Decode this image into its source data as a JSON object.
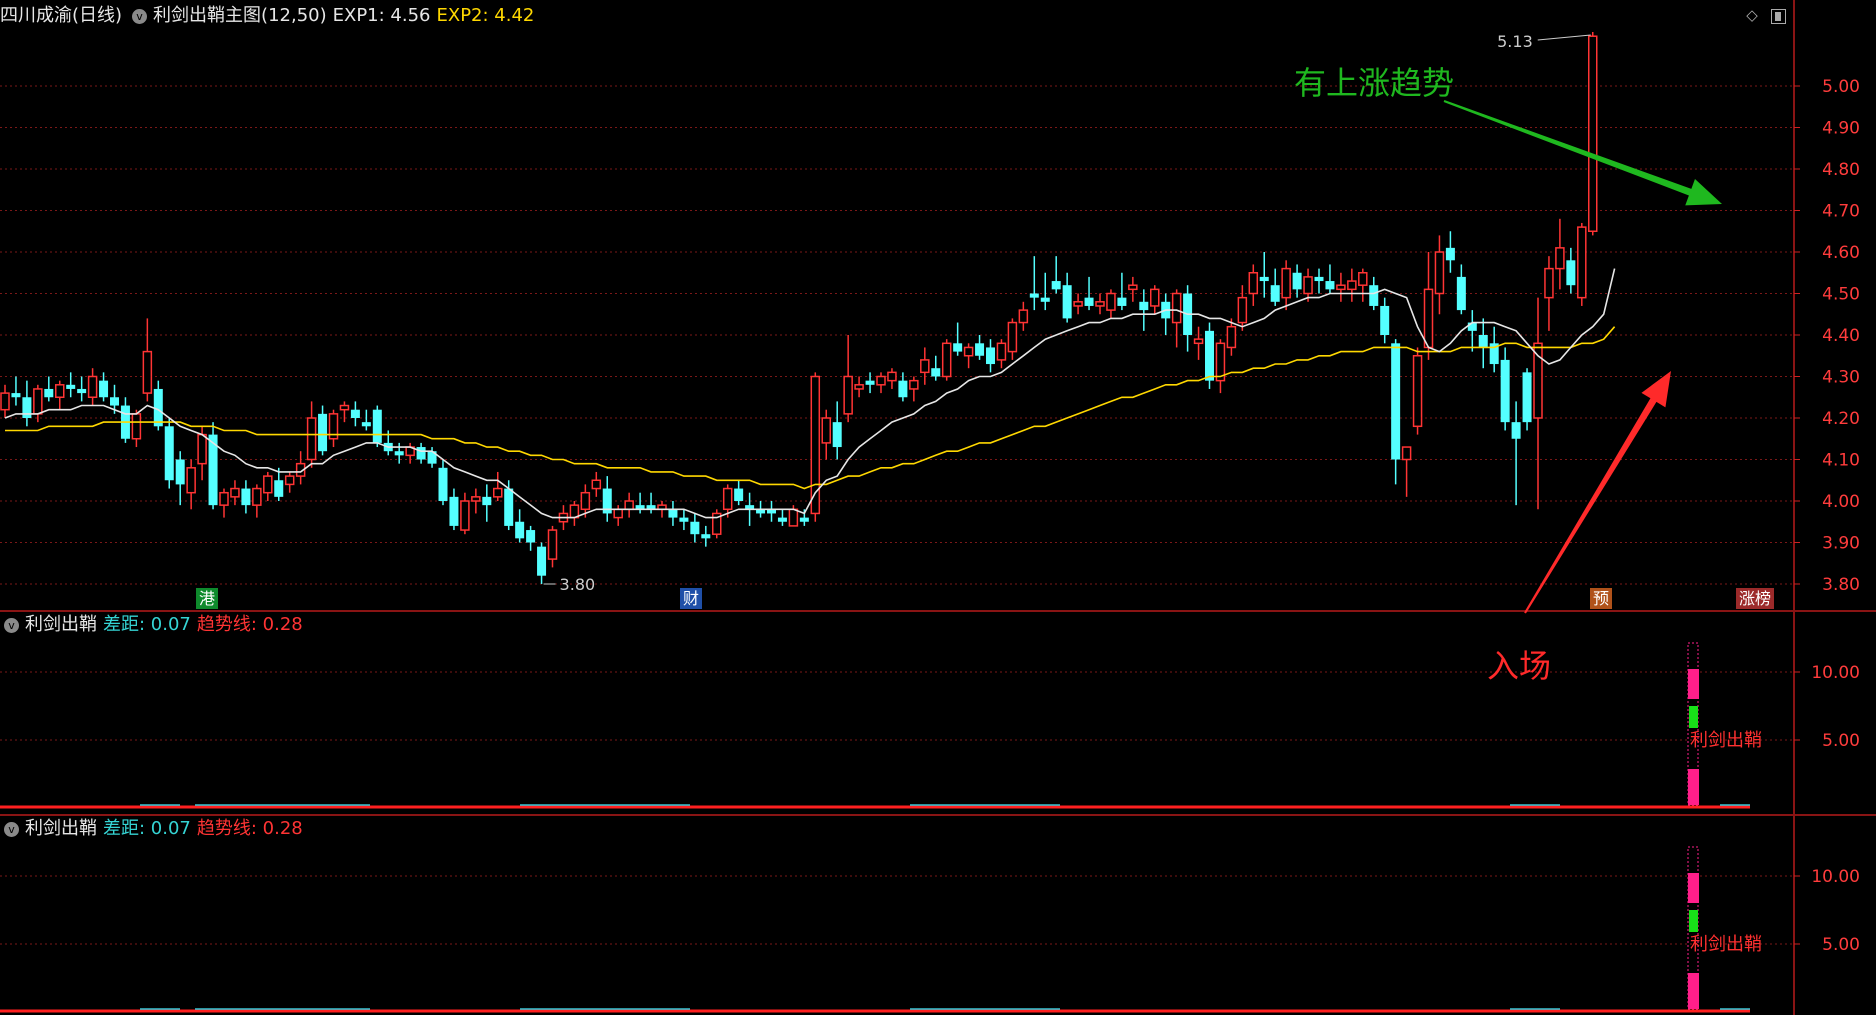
{
  "main": {
    "title_stock": "四川成渝(日线)",
    "indicator_name": "利剑出鞘主图(12,50)",
    "exp1_label": "EXP1: 4.56",
    "exp2_label": "EXP2: 4.42",
    "price_axis_labels": [
      "5.00",
      "4.90",
      "4.80",
      "4.70",
      "4.60",
      "4.50",
      "4.40",
      "4.30",
      "4.20",
      "4.10",
      "4.00",
      "3.90",
      "3.80"
    ],
    "high_label": "5.13",
    "low_label": "3.80",
    "markers": {
      "hk": "港",
      "fin": "财",
      "pre": "预",
      "zb": "涨榜"
    }
  },
  "annotations": {
    "uptrend": "有上涨趋势",
    "entry": "入场"
  },
  "sub1": {
    "name": "利剑出鞘",
    "diff_label": "差距: 0.07",
    "trend_label": "趋势线: 0.28",
    "axis_labels": [
      "10.00",
      "5.00"
    ],
    "signal_text": "利剑出鞘"
  },
  "sub2": {
    "name": "利剑出鞘",
    "diff_label": "差距: 0.07",
    "trend_label": "趋势线: 0.28",
    "axis_labels": [
      "10.00",
      "5.00"
    ],
    "signal_text": "利剑出鞘"
  },
  "colors": {
    "background": "#000000",
    "up": "#ff3434",
    "down": "#54ffff",
    "grid": "#7a1818",
    "exp1_line": "#e6e6e6",
    "exp2_line": "#ffd800",
    "uptrend_arrow": "#1fb81f",
    "entry_arrow": "#ff2a2a",
    "signal_magenta": "#ff1f8a",
    "signal_green": "#18e018"
  },
  "candles": [
    [
      4.22,
      4.28,
      4.2,
      4.26
    ],
    [
      4.26,
      4.3,
      4.23,
      4.25
    ],
    [
      4.25,
      4.29,
      4.18,
      4.2
    ],
    [
      4.21,
      4.28,
      4.19,
      4.27
    ],
    [
      4.27,
      4.3,
      4.24,
      4.25
    ],
    [
      4.25,
      4.29,
      4.22,
      4.28
    ],
    [
      4.28,
      4.31,
      4.25,
      4.27
    ],
    [
      4.27,
      4.3,
      4.24,
      4.26
    ],
    [
      4.25,
      4.32,
      4.23,
      4.3
    ],
    [
      4.29,
      4.31,
      4.24,
      4.25
    ],
    [
      4.25,
      4.28,
      4.21,
      4.23
    ],
    [
      4.23,
      4.25,
      4.14,
      4.15
    ],
    [
      4.15,
      4.22,
      4.13,
      4.21
    ],
    [
      4.26,
      4.44,
      4.24,
      4.36
    ],
    [
      4.27,
      4.29,
      4.17,
      4.18
    ],
    [
      4.18,
      4.2,
      4.03,
      4.05
    ],
    [
      4.1,
      4.12,
      3.99,
      4.04
    ],
    [
      4.02,
      4.1,
      3.98,
      4.08
    ],
    [
      4.09,
      4.18,
      4.05,
      4.16
    ],
    [
      4.16,
      4.19,
      3.98,
      3.99
    ],
    [
      3.99,
      4.03,
      3.96,
      4.02
    ],
    [
      4.01,
      4.05,
      3.99,
      4.03
    ],
    [
      4.03,
      4.05,
      3.97,
      3.99
    ],
    [
      3.99,
      4.04,
      3.96,
      4.03
    ],
    [
      4.02,
      4.07,
      4.0,
      4.06
    ],
    [
      4.05,
      4.08,
      4.0,
      4.01
    ],
    [
      4.04,
      4.07,
      4.02,
      4.06
    ],
    [
      4.06,
      4.12,
      4.04,
      4.09
    ],
    [
      4.1,
      4.24,
      4.08,
      4.2
    ],
    [
      4.21,
      4.23,
      4.11,
      4.12
    ],
    [
      4.15,
      4.22,
      4.13,
      4.21
    ],
    [
      4.22,
      4.24,
      4.19,
      4.23
    ],
    [
      4.22,
      4.24,
      4.18,
      4.2
    ],
    [
      4.19,
      4.22,
      4.17,
      4.18
    ],
    [
      4.22,
      4.23,
      4.13,
      4.14
    ],
    [
      4.14,
      4.17,
      4.11,
      4.12
    ],
    [
      4.12,
      4.14,
      4.09,
      4.11
    ],
    [
      4.11,
      4.14,
      4.09,
      4.13
    ],
    [
      4.13,
      4.14,
      4.09,
      4.1
    ],
    [
      4.12,
      4.13,
      4.08,
      4.09
    ],
    [
      4.08,
      4.1,
      3.99,
      4.0
    ],
    [
      4.01,
      4.03,
      3.93,
      3.94
    ],
    [
      3.93,
      4.02,
      3.92,
      4.0
    ],
    [
      4.0,
      4.03,
      3.97,
      4.01
    ],
    [
      4.01,
      4.04,
      3.95,
      3.99
    ],
    [
      4.01,
      4.07,
      4.0,
      4.03
    ],
    [
      4.03,
      4.05,
      3.93,
      3.94
    ],
    [
      3.95,
      3.98,
      3.9,
      3.91
    ],
    [
      3.93,
      3.94,
      3.88,
      3.9
    ],
    [
      3.89,
      3.9,
      3.8,
      3.82
    ],
    [
      3.86,
      3.94,
      3.84,
      3.93
    ],
    [
      3.95,
      3.99,
      3.93,
      3.97
    ],
    [
      3.96,
      4.0,
      3.94,
      3.99
    ],
    [
      3.98,
      4.04,
      3.96,
      4.02
    ],
    [
      4.03,
      4.07,
      4.01,
      4.05
    ],
    [
      4.03,
      4.06,
      3.95,
      3.97
    ],
    [
      3.96,
      3.99,
      3.94,
      3.98
    ],
    [
      3.98,
      4.02,
      3.96,
      4.0
    ],
    [
      3.99,
      4.02,
      3.97,
      3.98
    ],
    [
      3.99,
      4.02,
      3.97,
      3.98
    ],
    [
      3.98,
      4.0,
      3.96,
      3.99
    ],
    [
      3.98,
      4.0,
      3.94,
      3.96
    ],
    [
      3.96,
      3.98,
      3.93,
      3.95
    ],
    [
      3.95,
      3.97,
      3.9,
      3.92
    ],
    [
      3.92,
      3.94,
      3.89,
      3.91
    ],
    [
      3.92,
      3.98,
      3.91,
      3.97
    ],
    [
      3.98,
      4.04,
      3.96,
      4.03
    ],
    [
      4.03,
      4.05,
      3.99,
      4.0
    ],
    [
      3.99,
      4.02,
      3.94,
      3.98
    ],
    [
      3.98,
      4.0,
      3.96,
      3.97
    ],
    [
      3.98,
      4.0,
      3.95,
      3.97
    ],
    [
      3.96,
      3.98,
      3.94,
      3.95
    ],
    [
      3.94,
      3.99,
      3.94,
      3.98
    ],
    [
      3.96,
      3.98,
      3.94,
      3.95
    ],
    [
      3.97,
      4.31,
      3.95,
      4.3
    ],
    [
      4.14,
      4.22,
      4.1,
      4.2
    ],
    [
      4.19,
      4.24,
      4.1,
      4.13
    ],
    [
      4.21,
      4.4,
      4.19,
      4.3
    ],
    [
      4.27,
      4.3,
      4.25,
      4.28
    ],
    [
      4.29,
      4.31,
      4.26,
      4.28
    ],
    [
      4.28,
      4.31,
      4.26,
      4.3
    ],
    [
      4.29,
      4.32,
      4.27,
      4.31
    ],
    [
      4.29,
      4.31,
      4.24,
      4.25
    ],
    [
      4.27,
      4.3,
      4.24,
      4.29
    ],
    [
      4.31,
      4.37,
      4.28,
      4.34
    ],
    [
      4.32,
      4.35,
      4.29,
      4.3
    ],
    [
      4.3,
      4.39,
      4.29,
      4.38
    ],
    [
      4.38,
      4.43,
      4.35,
      4.36
    ],
    [
      4.35,
      4.38,
      4.32,
      4.37
    ],
    [
      4.38,
      4.4,
      4.34,
      4.35
    ],
    [
      4.37,
      4.39,
      4.31,
      4.33
    ],
    [
      4.34,
      4.39,
      4.32,
      4.38
    ],
    [
      4.36,
      4.44,
      4.34,
      4.43
    ],
    [
      4.43,
      4.48,
      4.41,
      4.46
    ],
    [
      4.5,
      4.59,
      4.46,
      4.49
    ],
    [
      4.49,
      4.55,
      4.46,
      4.48
    ],
    [
      4.53,
      4.59,
      4.5,
      4.51
    ],
    [
      4.52,
      4.55,
      4.43,
      4.44
    ],
    [
      4.47,
      4.5,
      4.45,
      4.48
    ],
    [
      4.49,
      4.54,
      4.46,
      4.47
    ],
    [
      4.47,
      4.5,
      4.45,
      4.48
    ],
    [
      4.46,
      4.51,
      4.44,
      4.5
    ],
    [
      4.49,
      4.55,
      4.46,
      4.47
    ],
    [
      4.51,
      4.54,
      4.48,
      4.52
    ],
    [
      4.48,
      4.51,
      4.41,
      4.46
    ],
    [
      4.47,
      4.52,
      4.45,
      4.51
    ],
    [
      4.48,
      4.5,
      4.4,
      4.44
    ],
    [
      4.43,
      4.51,
      4.37,
      4.5
    ],
    [
      4.5,
      4.52,
      4.36,
      4.4
    ],
    [
      4.38,
      4.42,
      4.34,
      4.39
    ],
    [
      4.41,
      4.43,
      4.27,
      4.29
    ],
    [
      4.29,
      4.39,
      4.26,
      4.38
    ],
    [
      4.37,
      4.44,
      4.35,
      4.42
    ],
    [
      4.43,
      4.52,
      4.41,
      4.49
    ],
    [
      4.5,
      4.57,
      4.47,
      4.55
    ],
    [
      4.54,
      4.6,
      4.49,
      4.53
    ],
    [
      4.52,
      4.56,
      4.47,
      4.48
    ],
    [
      4.49,
      4.58,
      4.46,
      4.56
    ],
    [
      4.55,
      4.57,
      4.49,
      4.51
    ],
    [
      4.5,
      4.56,
      4.48,
      4.54
    ],
    [
      4.54,
      4.56,
      4.5,
      4.53
    ],
    [
      4.53,
      4.57,
      4.5,
      4.51
    ],
    [
      4.51,
      4.55,
      4.48,
      4.52
    ],
    [
      4.51,
      4.56,
      4.48,
      4.53
    ],
    [
      4.52,
      4.56,
      4.48,
      4.55
    ],
    [
      4.52,
      4.54,
      4.46,
      4.47
    ],
    [
      4.47,
      4.49,
      4.38,
      4.4
    ],
    [
      4.38,
      4.39,
      4.04,
      4.1
    ],
    [
      4.1,
      4.13,
      4.01,
      4.13
    ],
    [
      4.18,
      4.37,
      4.16,
      4.35
    ],
    [
      4.37,
      4.6,
      4.34,
      4.51
    ],
    [
      4.5,
      4.64,
      4.45,
      4.6
    ],
    [
      4.61,
      4.65,
      4.55,
      4.58
    ],
    [
      4.54,
      4.57,
      4.45,
      4.46
    ],
    [
      4.43,
      4.46,
      4.36,
      4.41
    ],
    [
      4.4,
      4.44,
      4.32,
      4.37
    ],
    [
      4.38,
      4.42,
      4.31,
      4.33
    ],
    [
      4.34,
      4.37,
      4.17,
      4.19
    ],
    [
      4.19,
      4.24,
      3.99,
      4.15
    ],
    [
      4.31,
      4.32,
      4.17,
      4.19
    ],
    [
      4.2,
      4.49,
      3.98,
      4.38
    ],
    [
      4.49,
      4.59,
      4.41,
      4.56
    ],
    [
      4.56,
      4.68,
      4.51,
      4.61
    ],
    [
      4.58,
      4.61,
      4.5,
      4.52
    ],
    [
      4.49,
      4.67,
      4.47,
      4.66
    ],
    [
      4.65,
      5.13,
      4.64,
      5.12
    ]
  ],
  "exp1": [
    4.2,
    4.21,
    4.21,
    4.21,
    4.22,
    4.22,
    4.22,
    4.23,
    4.23,
    4.23,
    4.22,
    4.21,
    4.21,
    4.23,
    4.22,
    4.2,
    4.18,
    4.17,
    4.16,
    4.14,
    4.12,
    4.11,
    4.09,
    4.08,
    4.08,
    4.07,
    4.07,
    4.07,
    4.09,
    4.09,
    4.11,
    4.12,
    4.13,
    4.14,
    4.14,
    4.13,
    4.13,
    4.13,
    4.12,
    4.12,
    4.1,
    4.08,
    4.07,
    4.06,
    4.05,
    4.05,
    4.03,
    4.01,
    3.99,
    3.97,
    3.96,
    3.96,
    3.96,
    3.97,
    3.98,
    3.98,
    3.98,
    3.98,
    3.98,
    3.98,
    3.98,
    3.98,
    3.98,
    3.97,
    3.96,
    3.96,
    3.97,
    3.98,
    3.98,
    3.98,
    3.98,
    3.98,
    3.98,
    3.97,
    4.02,
    4.05,
    4.06,
    4.1,
    4.13,
    4.15,
    4.17,
    4.19,
    4.2,
    4.21,
    4.23,
    4.24,
    4.26,
    4.27,
    4.29,
    4.3,
    4.3,
    4.31,
    4.33,
    4.35,
    4.37,
    4.39,
    4.4,
    4.41,
    4.42,
    4.43,
    4.43,
    4.44,
    4.44,
    4.45,
    4.45,
    4.45,
    4.46,
    4.46,
    4.45,
    4.45,
    4.44,
    4.44,
    4.43,
    4.42,
    4.43,
    4.44,
    4.46,
    4.47,
    4.48,
    4.49,
    4.49,
    4.5,
    4.5,
    4.5,
    4.5,
    4.5,
    4.51,
    4.5,
    4.49,
    4.42,
    4.37,
    4.36,
    4.38,
    4.41,
    4.43,
    4.43,
    4.43,
    4.42,
    4.41,
    4.38,
    4.35,
    4.33,
    4.34,
    4.37,
    4.4,
    4.42,
    4.45,
    4.56
  ],
  "exp2": [
    4.17,
    4.17,
    4.17,
    4.17,
    4.18,
    4.18,
    4.18,
    4.18,
    4.18,
    4.19,
    4.19,
    4.19,
    4.19,
    4.19,
    4.19,
    4.19,
    4.19,
    4.18,
    4.18,
    4.18,
    4.17,
    4.17,
    4.17,
    4.16,
    4.16,
    4.16,
    4.16,
    4.16,
    4.16,
    4.16,
    4.16,
    4.16,
    4.16,
    4.16,
    4.16,
    4.16,
    4.16,
    4.16,
    4.16,
    4.15,
    4.15,
    4.15,
    4.14,
    4.14,
    4.13,
    4.13,
    4.12,
    4.12,
    4.11,
    4.11,
    4.1,
    4.1,
    4.09,
    4.09,
    4.09,
    4.08,
    4.08,
    4.08,
    4.08,
    4.07,
    4.07,
    4.07,
    4.06,
    4.06,
    4.06,
    4.05,
    4.05,
    4.05,
    4.05,
    4.04,
    4.04,
    4.04,
    4.04,
    4.03,
    4.04,
    4.04,
    4.05,
    4.06,
    4.06,
    4.07,
    4.08,
    4.08,
    4.09,
    4.09,
    4.1,
    4.11,
    4.12,
    4.12,
    4.13,
    4.14,
    4.14,
    4.15,
    4.16,
    4.17,
    4.18,
    4.18,
    4.19,
    4.2,
    4.21,
    4.22,
    4.23,
    4.24,
    4.25,
    4.25,
    4.26,
    4.27,
    4.28,
    4.28,
    4.29,
    4.29,
    4.3,
    4.3,
    4.31,
    4.31,
    4.32,
    4.32,
    4.33,
    4.33,
    4.34,
    4.34,
    4.35,
    4.35,
    4.36,
    4.36,
    4.36,
    4.37,
    4.37,
    4.37,
    4.37,
    4.36,
    4.36,
    4.36,
    4.36,
    4.37,
    4.37,
    4.37,
    4.37,
    4.38,
    4.38,
    4.37,
    4.37,
    4.37,
    4.37,
    4.37,
    4.38,
    4.38,
    4.39,
    4.42
  ]
}
